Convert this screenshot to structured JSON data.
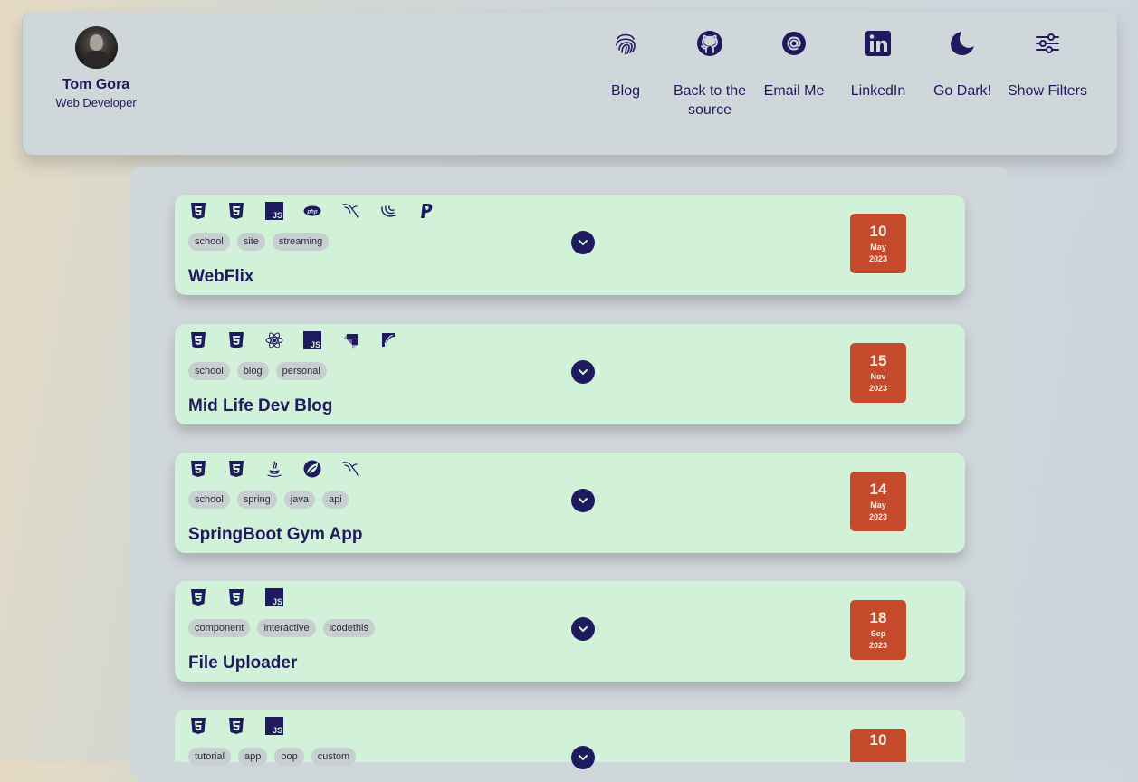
{
  "profile": {
    "name": "Tom Gora",
    "role": "Web Developer"
  },
  "nav": [
    {
      "label": "Blog",
      "icon": "fingerprint-icon"
    },
    {
      "label": "Back to the source",
      "icon": "github-icon"
    },
    {
      "label": "Email Me",
      "icon": "at-icon"
    },
    {
      "label": "LinkedIn",
      "icon": "linkedin-icon"
    },
    {
      "label": "Go Dark!",
      "icon": "moon-icon"
    },
    {
      "label": "Show Filters",
      "icon": "sliders-icon"
    }
  ],
  "colors": {
    "accent": "#1f1a5e",
    "card": "#d1f2d8",
    "date_badge": "#c54a2b",
    "panel": "#d0d7db"
  },
  "projects": [
    {
      "title": "WebFlix",
      "tech": [
        "html5-icon",
        "css3-icon",
        "js-icon",
        "php-icon",
        "mysql-icon",
        "jquery-icon",
        "paypal-icon"
      ],
      "tags": [
        "school",
        "site",
        "streaming"
      ],
      "date": {
        "day": "10",
        "month": "May",
        "year": "2023"
      }
    },
    {
      "title": "Mid Life Dev Blog",
      "tech": [
        "html5-icon",
        "css3-icon",
        "react-icon",
        "js-icon",
        "strapi-icon",
        "feather-icon"
      ],
      "tags": [
        "school",
        "blog",
        "personal"
      ],
      "date": {
        "day": "15",
        "month": "Nov",
        "year": "2023"
      }
    },
    {
      "title": "SpringBoot Gym App",
      "tech": [
        "html5-icon",
        "css3-icon",
        "java-icon",
        "spring-icon",
        "mysql-icon"
      ],
      "tags": [
        "school",
        "spring",
        "java",
        "api"
      ],
      "date": {
        "day": "14",
        "month": "May",
        "year": "2023"
      }
    },
    {
      "title": "File Uploader",
      "tech": [
        "html5-icon",
        "css3-icon",
        "js-icon"
      ],
      "tags": [
        "component",
        "interactive",
        "icodethis"
      ],
      "date": {
        "day": "18",
        "month": "Sep",
        "year": "2023"
      }
    },
    {
      "title": "",
      "tech": [
        "html5-icon",
        "css3-icon",
        "js-icon"
      ],
      "tags": [
        "tutorial",
        "app",
        "oop",
        "custom"
      ],
      "date": {
        "day": "10",
        "month": "",
        "year": ""
      }
    }
  ]
}
